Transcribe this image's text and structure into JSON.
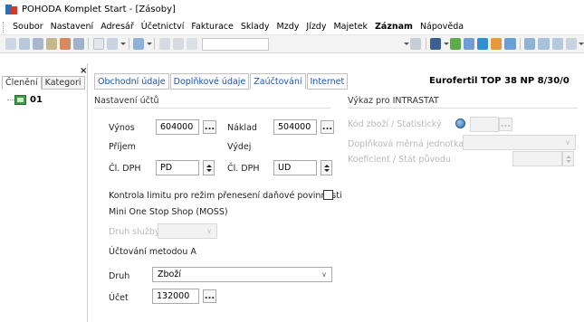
{
  "window": {
    "title": "POHODA Komplet Start - [Zásoby]"
  },
  "menu": {
    "items": [
      {
        "label": "Soubor",
        "bold": false
      },
      {
        "label": "Nastavení",
        "bold": false
      },
      {
        "label": "Adresář",
        "bold": false
      },
      {
        "label": "Účetnictví",
        "bold": false
      },
      {
        "label": "Fakturace",
        "bold": false
      },
      {
        "label": "Sklady",
        "bold": false
      },
      {
        "label": "Mzdy",
        "bold": false
      },
      {
        "label": "Jízdy",
        "bold": false
      },
      {
        "label": "Majetek",
        "bold": false
      },
      {
        "label": "Záznam",
        "bold": true
      },
      {
        "label": "Nápověda",
        "bold": false
      }
    ]
  },
  "left_panel": {
    "tabs": [
      "Členění",
      "Kategori"
    ],
    "tree_items": [
      {
        "label": "01"
      }
    ]
  },
  "main": {
    "tabs": [
      "Obchodní údaje",
      "Doplňkové údaje",
      "Zaúčtování",
      "Internet"
    ],
    "active_tab": "Zaúčtování",
    "doc_header": "Eurofertil TOP 38 NP 8/30/0",
    "nastaveni_uctu": {
      "title": "Nastavení účtů",
      "vynos_label": "Výnos",
      "vynos_value": "604000",
      "naklad_label": "Náklad",
      "naklad_value": "504000",
      "prijem_label": "Příjem",
      "vydej_label": "Výdej",
      "cl_dph_label": "Čl. DPH",
      "prijem_dph_value": "PD",
      "vydej_dph_value": "UD"
    },
    "kontrola_limitu_label": "Kontrola limitu pro režim přenesení daňové povinnosti",
    "moss": {
      "title": "Mini One Stop Shop (MOSS)",
      "druh_sluzby_label": "Druh služby"
    },
    "uctovani_metodou_a": {
      "title": "Účtování metodou A",
      "druh_label": "Druh",
      "druh_value": "Zboží",
      "ucet_label": "Účet",
      "ucet_value": "132000"
    },
    "intrastat": {
      "title": "Výkaz pro INTRASTAT",
      "kod_zbozi_label": "Kód zboží / Statistický",
      "doplnkova_label": "Doplňková měrná jednotka",
      "koeficient_label": "Koeficient / Stát původu"
    }
  },
  "buttons": {
    "ellipsis": "...",
    "chevron": "∨"
  },
  "colors": {
    "tab_text": "#1a56b8",
    "disabled_text": "#b9b9b9"
  },
  "icons": [
    "app-icon",
    "globe-icon",
    "tree-folder-icon",
    "close-icon"
  ]
}
